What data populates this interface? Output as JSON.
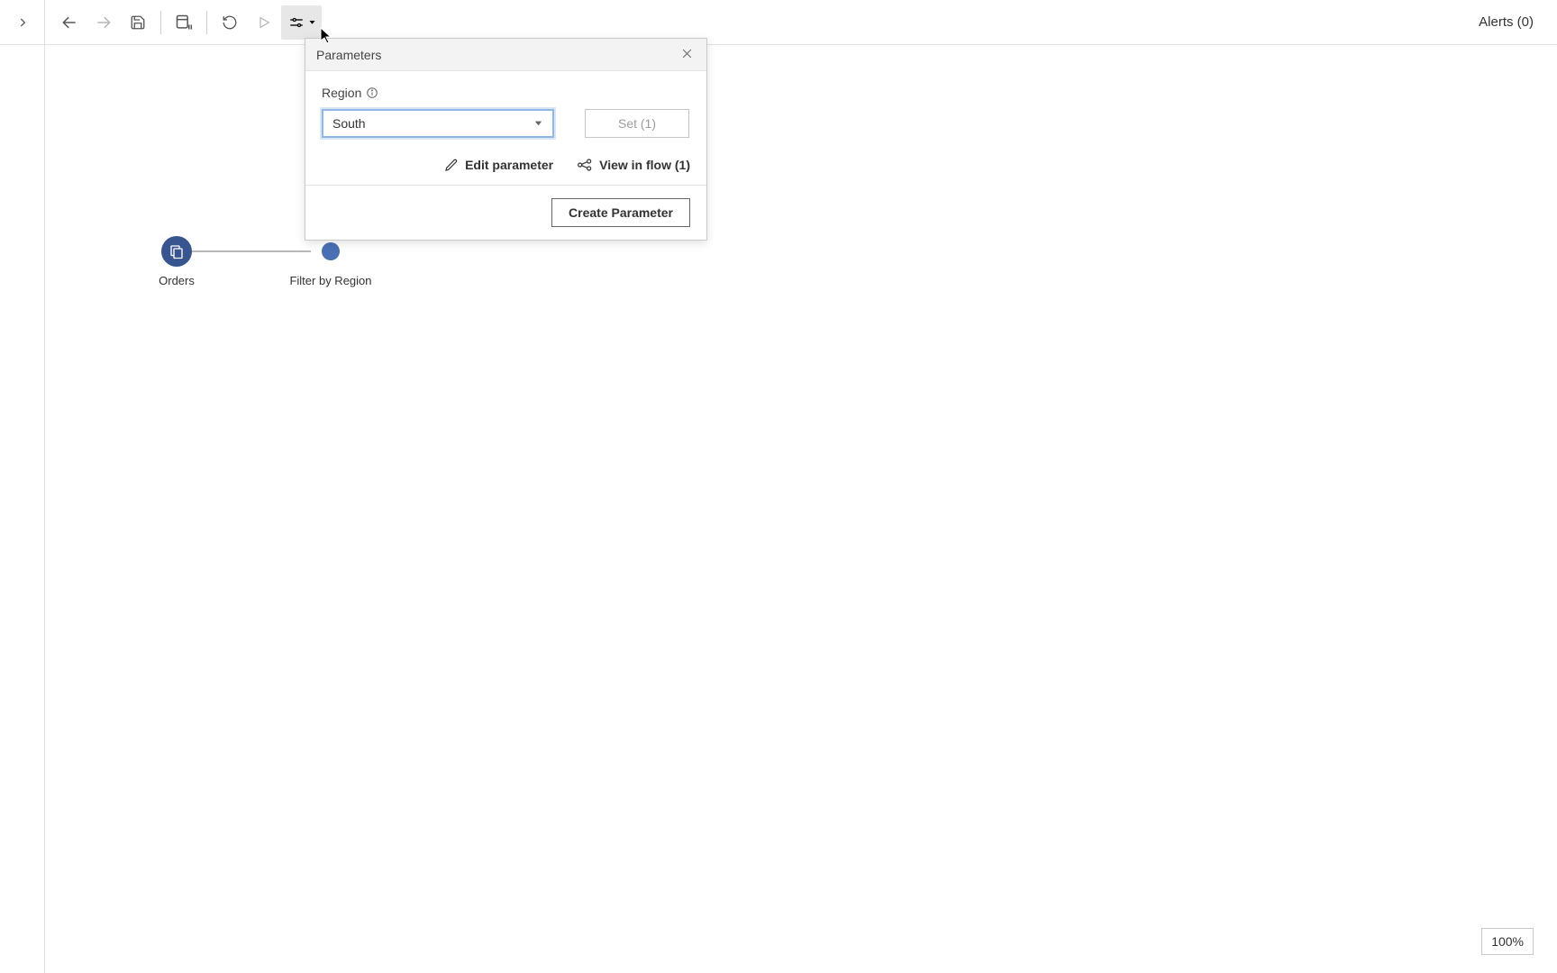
{
  "toolbar": {
    "alerts_label": "Alerts (0)"
  },
  "nodes": {
    "orders_label": "Orders",
    "filter_label": "Filter by Region"
  },
  "popover": {
    "title": "Parameters",
    "field_label": "Region",
    "selected_value": "South",
    "set_button_label": "Set (1)",
    "edit_label": "Edit parameter",
    "view_in_flow_label": "View in flow (1)",
    "create_label": "Create Parameter"
  },
  "zoom": {
    "label": "100%"
  }
}
